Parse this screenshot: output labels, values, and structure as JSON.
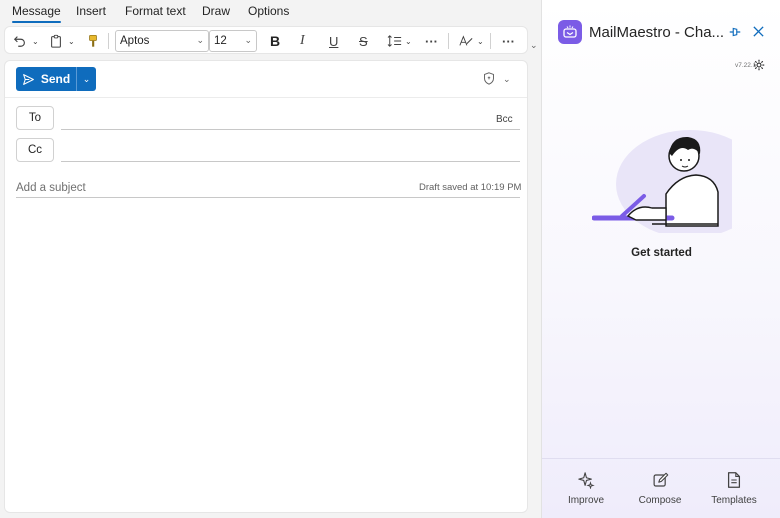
{
  "tabs": [
    {
      "label": "Message",
      "active": true
    },
    {
      "label": "Insert"
    },
    {
      "label": "Format text"
    },
    {
      "label": "Draw"
    },
    {
      "label": "Options"
    }
  ],
  "ribbon": {
    "font_name": "Aptos",
    "font_size": "12",
    "icons": [
      "undo-icon",
      "paste-icon",
      "format-painter-icon",
      "bold-icon",
      "italic-icon",
      "underline-icon",
      "strikethrough-icon",
      "paragraph-spacing-icon",
      "more-icon",
      "editor-icon",
      "more-icon"
    ]
  },
  "compose": {
    "send_label": "Send",
    "to_label": "To",
    "cc_label": "Cc",
    "bcc_label": "Bcc",
    "subject_placeholder": "Add a subject",
    "draft_status": "Draft saved at 10:19 PM",
    "accent": "#0f6cbd"
  },
  "panel": {
    "title": "MailMaestro - Cha...",
    "version": "v7.22.1",
    "get_started": "Get started",
    "brand_color": "#7b5ce6",
    "footer": [
      {
        "label": "Improve",
        "icon": "sparkle-icon"
      },
      {
        "label": "Compose",
        "icon": "compose-icon"
      },
      {
        "label": "Templates",
        "icon": "template-icon"
      }
    ]
  }
}
